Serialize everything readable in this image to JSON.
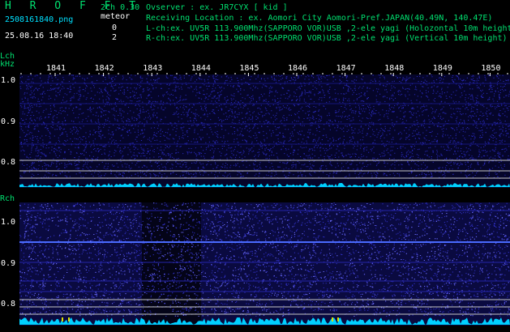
{
  "header": {
    "brand": "H R O F F T",
    "filename": "2508161840.png",
    "datetime": "25.08.16 18:40",
    "mode": "2ch 0.30",
    "meteor_label": "meteor",
    "count_l": "0",
    "count_r": "2",
    "observer": "Ovserver            : ex. JR7CYX [ kid ]",
    "location": "Receiving Location : ex. Aomori City Aomori-Pref.JAPAN(40.49N, 140.47E)",
    "lch_info": "L-ch:ex. UV5R 113.900Mhz(SAPPORO VOR)USB ,2-ele yagi (Holozontal 10m height",
    "rch_info": "R-ch:ex. UV5R 113.900Mhz(SAPPORO VOR)USB ,2-ele yagi (Vertical 10m height)"
  },
  "axis": {
    "lch_label": "Lch",
    "unit": "kHz",
    "rch_label": "Rch",
    "time_ticks": [
      "1841",
      "1842",
      "1843",
      "1844",
      "1845",
      "1846",
      "1847",
      "1848",
      "1849",
      "1850"
    ],
    "lch_freq_ticks": [
      "1.0",
      "0.9",
      "0.8"
    ],
    "rch_freq_ticks": [
      "1.0",
      "0.9",
      "0.8"
    ]
  },
  "colors": {
    "background": "#000000",
    "header_text": "#00e070",
    "spectrum_noise": "#1a1aa0",
    "level_bar": "#00d0ff",
    "axis_text": "#ffffff"
  }
}
